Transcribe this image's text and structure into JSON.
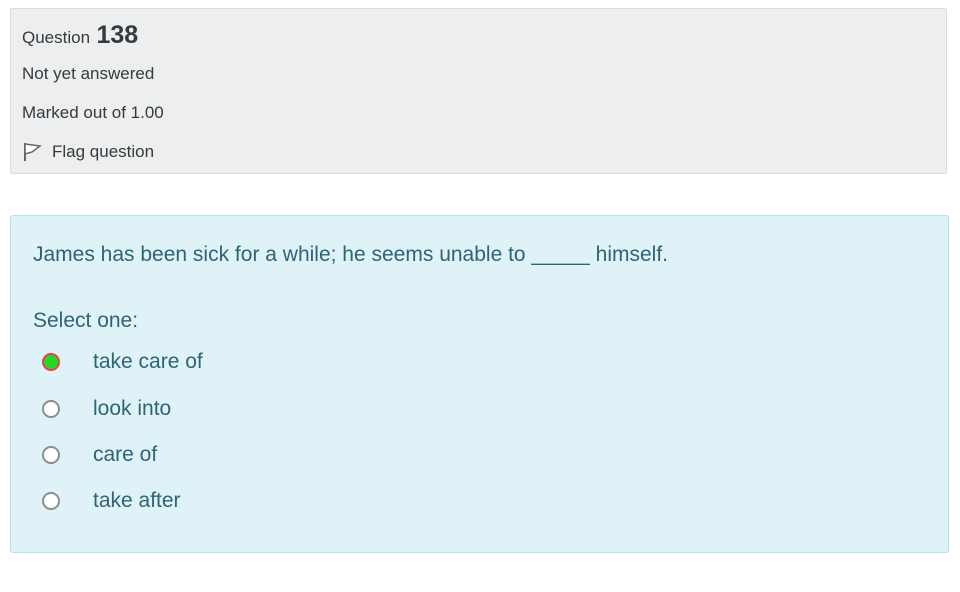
{
  "info": {
    "question_label": "Question",
    "question_number": "138",
    "state": "Not yet answered",
    "grade": "Marked out of 1.00",
    "flag_label": "Flag question",
    "flag_icon": "flag-icon"
  },
  "question": {
    "text": "James has been sick for a while; he seems unable to _____ himself.",
    "prompt": "Select one:",
    "options": [
      {
        "label": "take care of",
        "selected": true
      },
      {
        "label": "look into",
        "selected": false
      },
      {
        "label": "care of",
        "selected": false
      },
      {
        "label": "take after",
        "selected": false
      }
    ]
  },
  "colors": {
    "info_bg": "#eceeef",
    "question_bg": "#def2f8",
    "question_text": "#2f6473",
    "selected_fill": "#27d727",
    "selected_border": "#e04848"
  }
}
